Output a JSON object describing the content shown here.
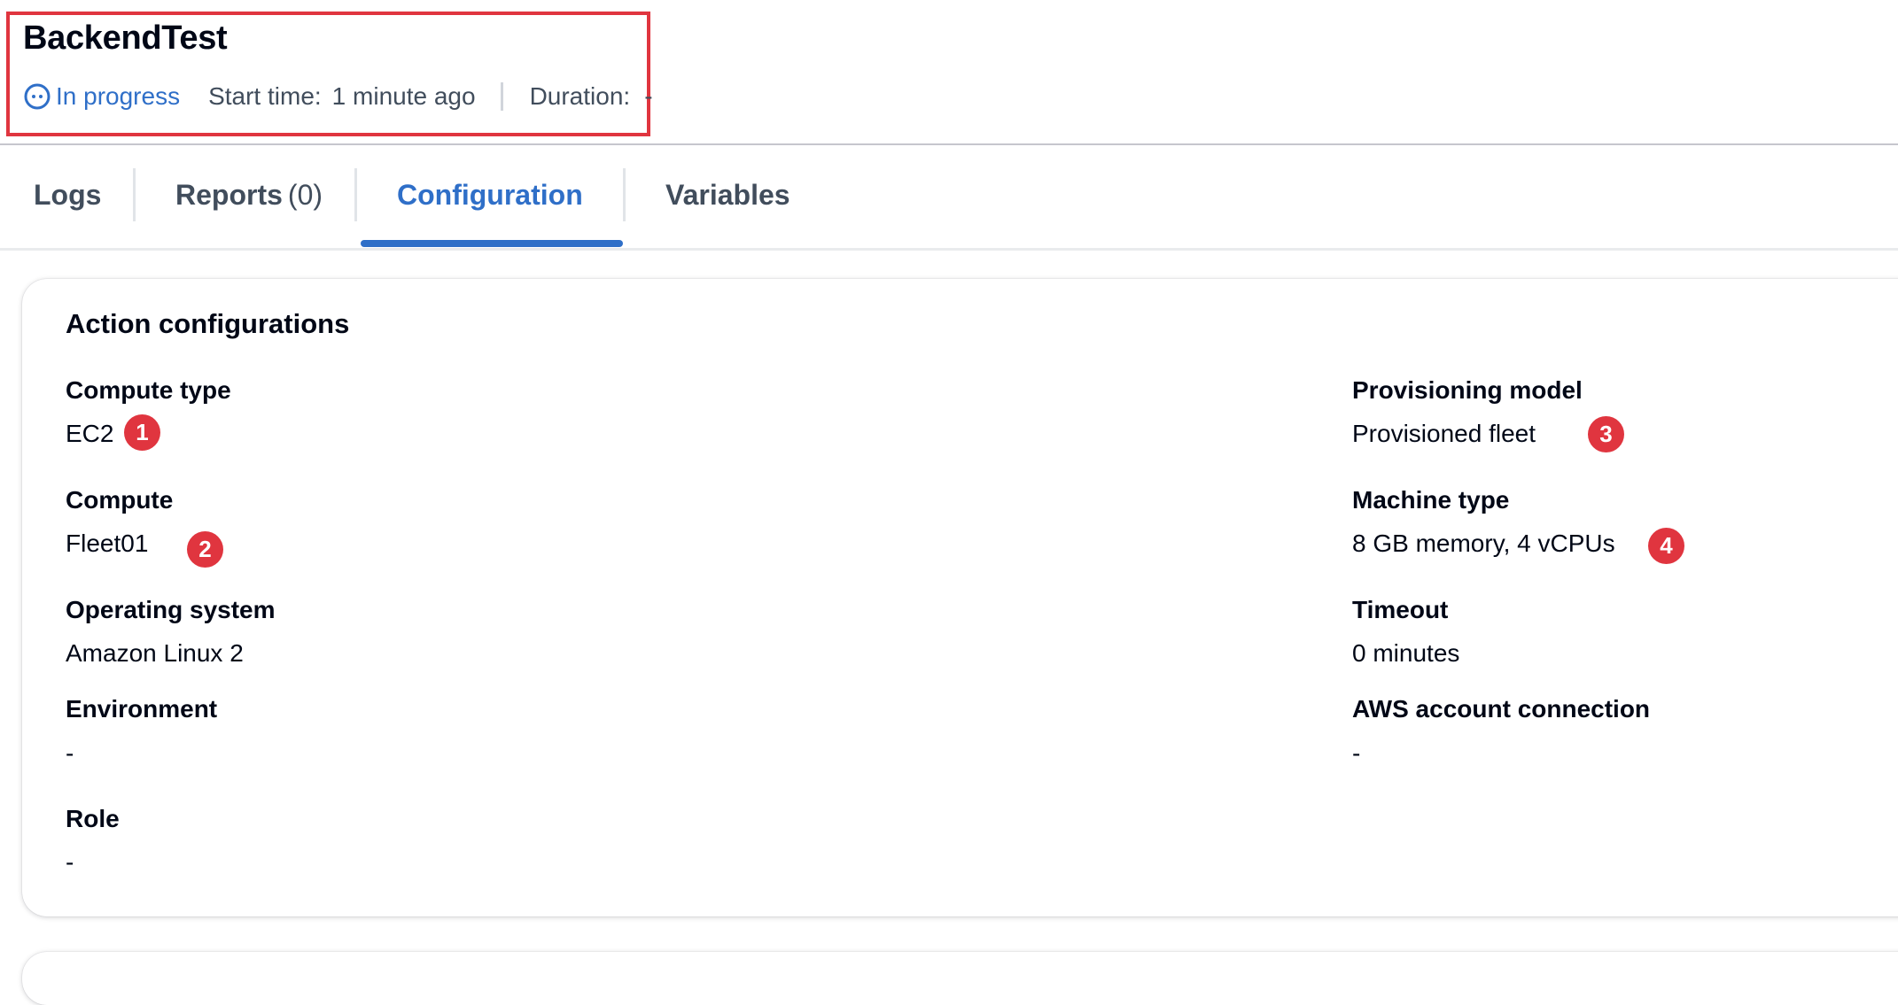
{
  "run": {
    "title": "BackendTest",
    "status": "In progress",
    "start_time_label": "Start time:",
    "start_time_value": "1 minute ago",
    "duration_label": "Duration:",
    "duration_value": "-"
  },
  "tabs": [
    {
      "label": "Logs",
      "count": ""
    },
    {
      "label": "Reports",
      "count": "(0)"
    },
    {
      "label": "Configuration",
      "count": "",
      "active": true
    },
    {
      "label": "Variables",
      "count": ""
    }
  ],
  "config": {
    "title": "Action configurations",
    "left": [
      {
        "label": "Compute type",
        "value": "EC2",
        "marker": "1"
      },
      {
        "label": "Compute",
        "value": "Fleet01",
        "marker": "2"
      },
      {
        "label": "Operating system",
        "value": "Amazon Linux 2"
      },
      {
        "label": "Environment",
        "value": "-"
      },
      {
        "label": "Role",
        "value": "-"
      }
    ],
    "right": [
      {
        "label": "Provisioning model",
        "value": "Provisioned fleet",
        "marker": "3"
      },
      {
        "label": "Machine type",
        "value": "8 GB memory, 4 vCPUs",
        "marker": "4"
      },
      {
        "label": "Timeout",
        "value": "0 minutes"
      },
      {
        "label": "AWS account connection",
        "value": "-"
      }
    ]
  },
  "colors": {
    "accent": "#2f6fc8",
    "annotation": "#e0353f",
    "text": "#000716"
  }
}
